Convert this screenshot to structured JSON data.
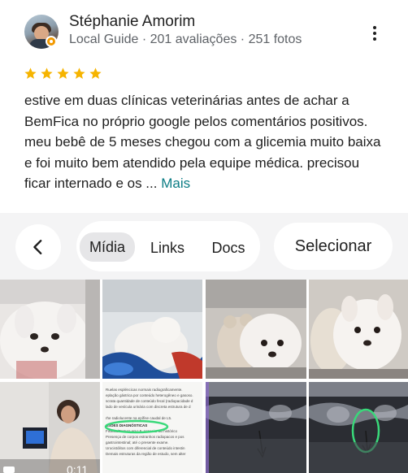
{
  "review": {
    "author_name": "Stéphanie Amorim",
    "author_meta": "Local Guide · 201 avaliações · 251 fotos",
    "rating": 5,
    "text": "estive em duas clínicas veterinárias antes de achar a BemFica no próprio google pelos comentários positivos. meu bebê de 5 meses chegou com a glicemia muito baixa e foi muito bem atendido pela equipe médica. precisou ficar internado e os ... ",
    "more_label": "Mais"
  },
  "toolbar": {
    "tabs": [
      {
        "label": "Mídia",
        "selected": true
      },
      {
        "label": "Links",
        "selected": false
      },
      {
        "label": "Docs",
        "selected": false
      }
    ],
    "select_label": "Selecionar"
  },
  "media": {
    "video_duration": "0:11",
    "doc_text": [
      "Ruelas espléncicas normais radiograficamente.",
      "eplação gástrica por conteúdo heterogêneo e gasoso.",
      "scrata quantidade de conteúdo fecal (radiopacidade d",
      "lado de vesícula urinária com discreta estrutura de d",
      "",
      "rhe radiolucente na epífise caudal de L5.",
      "SSÕES DIAGNÓSTICAS",
      "Fissura/Fratura em L5. Associar ao histórico",
      "Presença de corpos estranhos radiopacos e pos",
      "gastrointestinal; até o presente exame.",
      "Urocistólitos com diferencial de conteúdo intestin",
      "Demais estruturas da região de estudo, sem alter"
    ]
  },
  "colors": {
    "star": "#f6b400",
    "more_link": "#0b7c84",
    "toolbar_bg": "#f4f4f5",
    "annotation_circle": "#39d97a"
  }
}
